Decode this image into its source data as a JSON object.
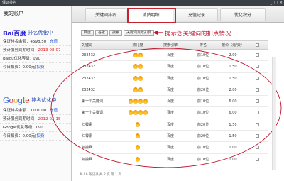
{
  "window": {
    "title": "保证排名",
    "controls": [
      "_",
      "□",
      "×"
    ]
  },
  "sidebar": {
    "title": "我的账户",
    "baidu": {
      "logo": "Bai百度",
      "rank_label": "排名优化中",
      "balance_label": "保证排名余额：",
      "balance": "4598.50",
      "recharge": "充值",
      "expiry_label": "预计服务到期时间：",
      "expiry": "2013-08-07",
      "level_label": "Baidu优化等级：Lv0",
      "today_label": "今日扣费：0.00元(",
      "today_link": "扣费",
      "today_end": ")"
    },
    "google": {
      "logo_letters": [
        "G",
        "o",
        "o",
        "g",
        "l",
        "e"
      ],
      "rank_label": "排名优化中",
      "balance_label": "保证排名余额：",
      "balance": "1101.00",
      "recharge": "充值",
      "expiry_label": "预计服务到期时间：",
      "expiry": "2012-02-15",
      "level_label": "Google优化等级：Lv0",
      "today_label": "今日扣费：0.00元(",
      "today_link": "扣费",
      "today_end": ")"
    }
  },
  "tabs": [
    "关键词排名",
    "消费明细",
    "充值记录",
    "优化积分"
  ],
  "active_tab": "消费明细",
  "subtabs": [
    "百度",
    "谷歌",
    "搜索",
    "关键词点数扣费"
  ],
  "annotation": "提示您关键词的扣点情况",
  "table": {
    "headers": [
      "关键词",
      "热门度",
      "搜索引擎",
      "排名",
      "报价（元/天）",
      ""
    ],
    "rows": [
      {
        "keyword": "232432",
        "flames": 2,
        "engine": "百度",
        "rank": "前10位",
        "price": "2.00"
      },
      {
        "keyword": "232432",
        "flames": 2,
        "engine": "百度",
        "rank": "前10位",
        "price": "1.50"
      },
      {
        "keyword": "232432",
        "flames": 2,
        "engine": "百度",
        "rank": "前10位",
        "price": "1.50"
      },
      {
        "keyword": "232432",
        "flames": 2,
        "engine": "百度",
        "rank": "前20位",
        "price": "2.00"
      },
      {
        "keyword": "第一个关键词",
        "flames": 4,
        "engine": "百度",
        "rank": "前10位",
        "price": "6.00"
      },
      {
        "keyword": "第一个关键词",
        "flames": 4,
        "engine": "百度",
        "rank": "前10位",
        "price": "6.00"
      },
      {
        "keyword": "红霉素",
        "flames": 1,
        "engine": "百度",
        "rank": "前20位",
        "price": "1.50"
      },
      {
        "keyword": "红霉素",
        "flames": 1,
        "engine": "百度",
        "rank": "前20位",
        "price": "1.50"
      },
      {
        "keyword": "扣操兵",
        "flames": 1,
        "engine": "百度",
        "rank": "前10位",
        "price": "1.00"
      },
      {
        "keyword": "扣操兵",
        "flames": 1,
        "engine": "百度",
        "rank": "前10位",
        "price": "1.00"
      }
    ]
  },
  "footer": "共 16 条记录 共 2 页 第 1 页",
  "colors": {
    "annotation": "#c0132a",
    "titlebar": "#3a3f45"
  }
}
